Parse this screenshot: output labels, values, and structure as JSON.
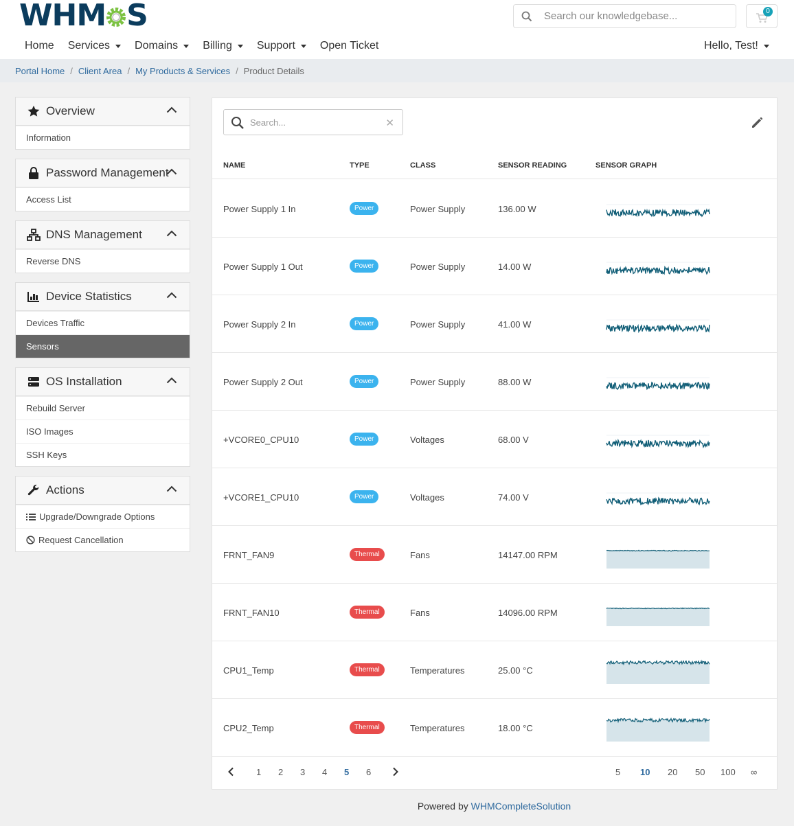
{
  "header": {
    "logo_text_left": "WHM",
    "logo_text_right": "S",
    "search_placeholder": "Search our knowledgebase...",
    "cart_count": "0",
    "greeting": "Hello, Test!"
  },
  "nav": [
    "Home",
    "Services",
    "Domains",
    "Billing",
    "Support",
    "Open Ticket"
  ],
  "breadcrumb": [
    "Portal Home",
    "Client Area",
    "My Products & Services",
    "Product Details"
  ],
  "sidebar": {
    "overview": {
      "title": "Overview",
      "items": [
        "Information"
      ]
    },
    "password": {
      "title": "Password Management",
      "items": [
        "Access List"
      ]
    },
    "dns": {
      "title": "DNS Management",
      "items": [
        "Reverse DNS"
      ]
    },
    "device": {
      "title": "Device Statistics",
      "items": [
        "Devices Traffic",
        "Sensors"
      ]
    },
    "os": {
      "title": "OS Installation",
      "items": [
        "Rebuild Server",
        "ISO Images",
        "SSH Keys"
      ]
    },
    "actions": {
      "title": "Actions",
      "items": [
        "Upgrade/Downgrade Options",
        "Request Cancellation"
      ]
    }
  },
  "table": {
    "search_placeholder": "Search...",
    "headers": {
      "name": "NAME",
      "type": "TYPE",
      "class": "CLASS",
      "reading": "SENSOR READING",
      "graph": "SENSOR GRAPH"
    },
    "rows": [
      {
        "name": "Power Supply 1 In",
        "type": "Power",
        "class": "Power Supply",
        "reading": "136.00 W"
      },
      {
        "name": "Power Supply 1 Out",
        "type": "Power",
        "class": "Power Supply",
        "reading": "14.00 W"
      },
      {
        "name": "Power Supply 2 In",
        "type": "Power",
        "class": "Power Supply",
        "reading": "41.00 W"
      },
      {
        "name": "Power Supply 2 Out",
        "type": "Power",
        "class": "Power Supply",
        "reading": "88.00 W"
      },
      {
        "name": "+VCORE0_CPU10",
        "type": "Power",
        "class": "Voltages",
        "reading": "68.00 V"
      },
      {
        "name": "+VCORE1_CPU10",
        "type": "Power",
        "class": "Voltages",
        "reading": "74.00 V"
      },
      {
        "name": "FRNT_FAN9",
        "type": "Thermal",
        "class": "Fans",
        "reading": "14147.00 RPM"
      },
      {
        "name": "FRNT_FAN10",
        "type": "Thermal",
        "class": "Fans",
        "reading": "14096.00 RPM"
      },
      {
        "name": "CPU1_Temp",
        "type": "Thermal",
        "class": "Temperatures",
        "reading": "25.00 °C"
      },
      {
        "name": "CPU2_Temp",
        "type": "Thermal",
        "class": "Temperatures",
        "reading": "18.00 °C"
      }
    ]
  },
  "pagination": {
    "pages": [
      "1",
      "2",
      "3",
      "4",
      "5",
      "6"
    ],
    "current": "5",
    "page_sizes": [
      "5",
      "10",
      "20",
      "50",
      "100",
      "∞"
    ],
    "current_size": "10"
  },
  "footer": {
    "prefix": "Powered by",
    "link": "WHMCompleteSolution"
  },
  "colors": {
    "power": "#3bb3ee",
    "thermal": "#e84c4c",
    "graph_line": "#115e77",
    "link": "#2f6a9e",
    "active_item": "#666666"
  }
}
